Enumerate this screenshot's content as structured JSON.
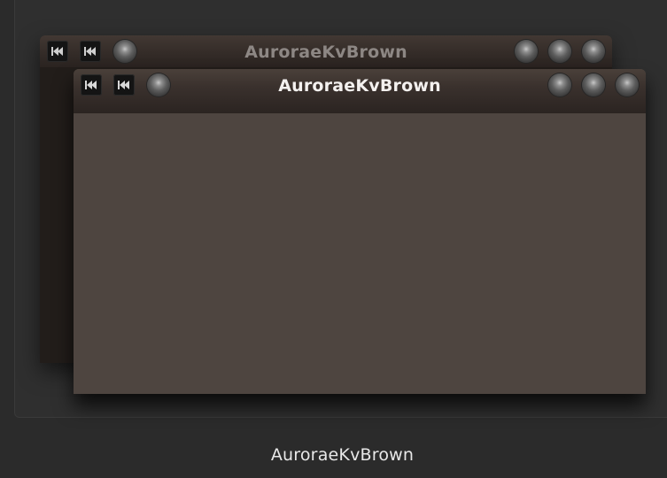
{
  "preview": {
    "label": "AuroraeKvBrown"
  },
  "back_window": {
    "title": "AuroraeKvBrown"
  },
  "front_window": {
    "title": "AuroraeKvBrown"
  },
  "icons": {
    "left_buttons": [
      "skip-back-icon",
      "skip-back-icon",
      "round-menu-icon"
    ],
    "right_buttons": [
      "minimize-knob-icon",
      "maximize-knob-icon",
      "close-knob-icon"
    ]
  },
  "colors": {
    "background": "#2b2b2b",
    "window_body": "#4e4540",
    "titlebar": "#3a322e",
    "active_title_text": "#f4f1ef",
    "inactive_title_text": "#8d8784"
  }
}
